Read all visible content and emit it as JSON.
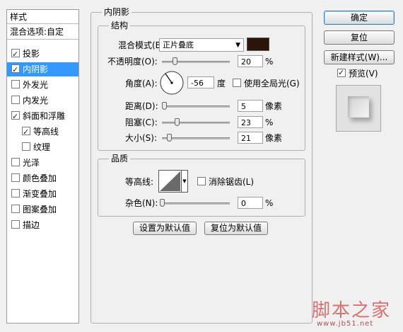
{
  "styles": {
    "header": "样式",
    "blend_options": "混合选项:自定",
    "items": [
      {
        "label": "投影",
        "checked": true,
        "active": false,
        "indent": false
      },
      {
        "label": "内阴影",
        "checked": true,
        "active": true,
        "indent": false
      },
      {
        "label": "外发光",
        "checked": false,
        "active": false,
        "indent": false
      },
      {
        "label": "内发光",
        "checked": false,
        "active": false,
        "indent": false
      },
      {
        "label": "斜面和浮雕",
        "checked": true,
        "active": false,
        "indent": false
      },
      {
        "label": "等高线",
        "checked": true,
        "active": false,
        "indent": true
      },
      {
        "label": "纹理",
        "checked": false,
        "active": false,
        "indent": true
      },
      {
        "label": "光泽",
        "checked": false,
        "active": false,
        "indent": false
      },
      {
        "label": "颜色叠加",
        "checked": false,
        "active": false,
        "indent": false
      },
      {
        "label": "渐变叠加",
        "checked": false,
        "active": false,
        "indent": false
      },
      {
        "label": "图案叠加",
        "checked": false,
        "active": false,
        "indent": false
      },
      {
        "label": "描边",
        "checked": false,
        "active": false,
        "indent": false
      }
    ]
  },
  "inner_shadow": {
    "title": "内阴影",
    "structure": {
      "title": "结构",
      "blend_mode_label": "混合模式(B):",
      "blend_mode_value": "正片叠底",
      "color": "#2a1508",
      "opacity_label": "不透明度(O):",
      "opacity_value": "20",
      "opacity_unit": "%",
      "angle_label": "角度(A):",
      "angle_value": "-56",
      "angle_unit": "度",
      "global_light_label": "使用全局光(G)",
      "global_light_checked": false,
      "distance_label": "距离(D):",
      "distance_value": "5",
      "distance_unit": "像素",
      "choke_label": "阻塞(C):",
      "choke_value": "23",
      "choke_unit": "%",
      "size_label": "大小(S):",
      "size_value": "21",
      "size_unit": "像素"
    },
    "quality": {
      "title": "品质",
      "contour_label": "等高线:",
      "antialias_label": "消除锯齿(L)",
      "antialias_checked": false,
      "noise_label": "杂色(N):",
      "noise_value": "0",
      "noise_unit": "%"
    },
    "make_default": "设置为默认值",
    "reset_default": "复位为默认值"
  },
  "actions": {
    "ok": "确定",
    "reset": "复位",
    "new_style": "新建样式(W)...",
    "preview_label": "预览(V)",
    "preview_checked": true
  },
  "watermark": {
    "text": "脚本之家",
    "url": "www.jb51.net"
  }
}
